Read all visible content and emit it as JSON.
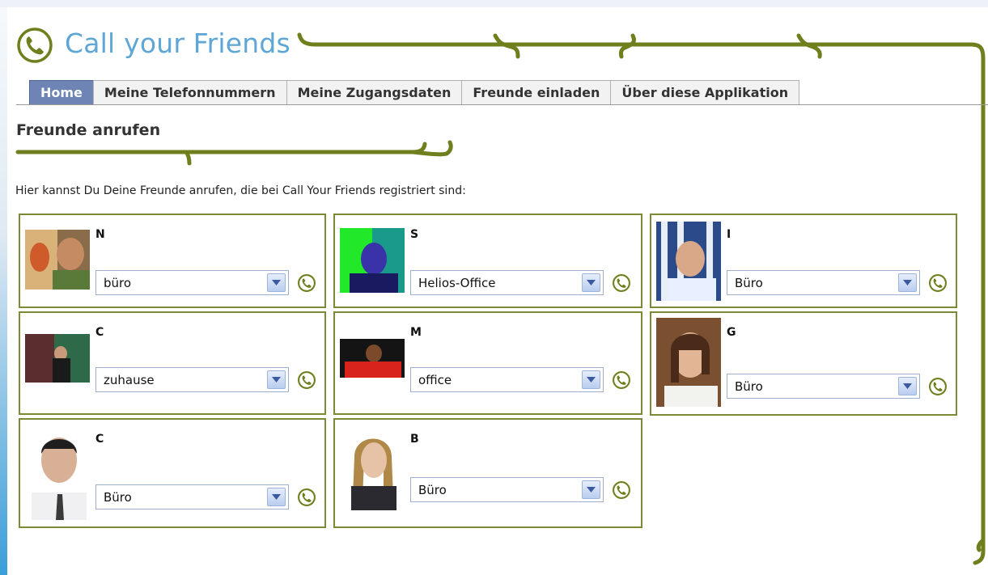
{
  "app": {
    "title": "Call your Friends"
  },
  "tabs": [
    {
      "label": "Home",
      "active": true
    },
    {
      "label": "Meine Telefonnummern",
      "active": false
    },
    {
      "label": "Meine Zugangsdaten",
      "active": false
    },
    {
      "label": "Freunde einladen",
      "active": false
    },
    {
      "label": "Über diese Applikation",
      "active": false
    }
  ],
  "page": {
    "title": "Freunde anrufen",
    "intro": "Hier kannst Du Deine Freunde anrufen, die bei Call Your Friends registriert sind:"
  },
  "friends": [
    {
      "name": "N",
      "phone": "büro"
    },
    {
      "name": "S",
      "phone": "Helios-Office"
    },
    {
      "name": "I",
      "phone": "Büro"
    },
    {
      "name": "C",
      "phone": "zuhause"
    },
    {
      "name": "M",
      "phone": "office"
    },
    {
      "name": "G",
      "phone": "Büro"
    },
    {
      "name": "C",
      "phone": "Büro"
    },
    {
      "name": "B",
      "phone": "Büro"
    }
  ],
  "colors": {
    "brand": "#5da6d5",
    "accent": "#6f7f1e",
    "active_tab": "#6d84b4",
    "card_border": "#7a8a35"
  },
  "icons": {
    "logo": "phone-circle-icon",
    "call": "phone-circle-icon",
    "dropdown": "chevron-down-icon"
  }
}
